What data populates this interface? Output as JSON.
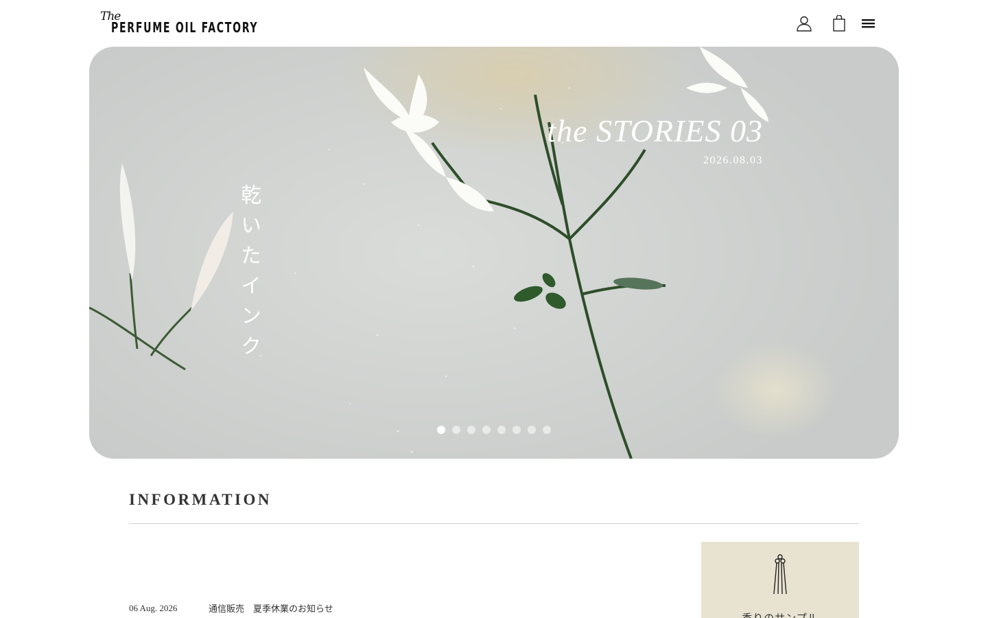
{
  "header": {
    "logo_the": "The",
    "logo_main": "PERFUME OIL FACTORY",
    "icons": [
      "user-icon",
      "shopping-bag-icon",
      "menu-icon"
    ]
  },
  "hero": {
    "title": "the STORIES 03",
    "date": "2026.08.03",
    "vertical_text": "乾いたインク",
    "slide_count": 8,
    "active_slide": 1
  },
  "information": {
    "heading": "INFORMATION",
    "items": [
      {
        "date": "06 Aug. 2026",
        "title": "通信販売　夏季休業のお知らせ"
      }
    ]
  },
  "sample_card": {
    "label": "香りのサンプル",
    "icon": "scent-strip-icon",
    "background": "#e8e2d1"
  }
}
